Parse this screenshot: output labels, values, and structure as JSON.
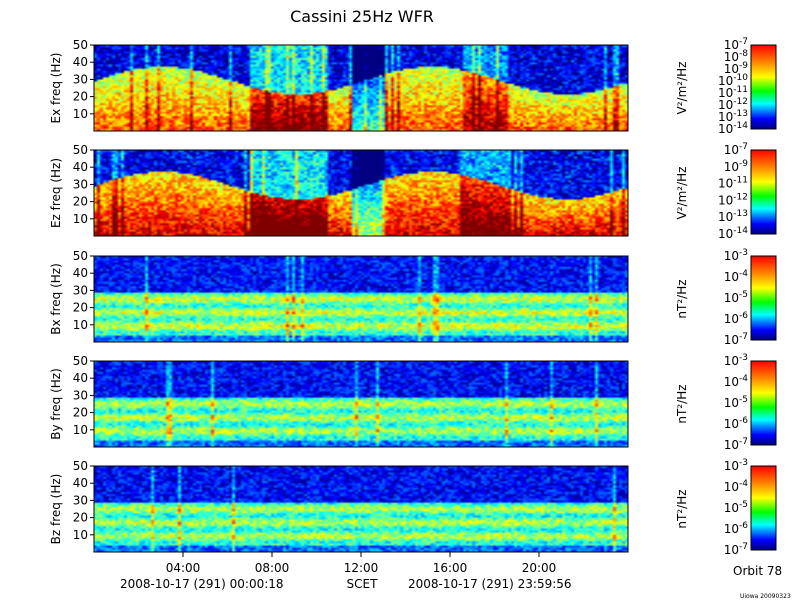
{
  "title": "Cassini 25Hz WFR",
  "chart_data": {
    "type": "heatmap",
    "title": "Cassini 25Hz WFR",
    "xlabel": "SCET",
    "xlim_hours": [
      0,
      24
    ],
    "x_ticks": [
      "04:00",
      "08:00",
      "12:00",
      "16:00",
      "20:00"
    ],
    "x_tick_hours": [
      4,
      8,
      12,
      16,
      20
    ],
    "start_time": "2008-10-17 (291) 00:00:18",
    "end_time": "2008-10-17 (291) 23:59:56",
    "panels": [
      {
        "ylabel": "Ex freq (Hz)",
        "ylim": [
          0,
          50
        ],
        "yticks": [
          "10",
          "20",
          "30",
          "40",
          "50"
        ],
        "colorbar_label": "V²/m²/Hz",
        "cmin_exp": -14,
        "cmax_exp": -7,
        "cbar_ticks": [
          "-7",
          "-8",
          "-9",
          "-10",
          "-11",
          "-12",
          "-13",
          "-14"
        ],
        "level": 1.0
      },
      {
        "ylabel": "Ez freq (Hz)",
        "ylim": [
          0,
          50
        ],
        "yticks": [
          "10",
          "20",
          "30",
          "40",
          "50"
        ],
        "colorbar_label": "V²/m²/Hz",
        "cmin_exp": -14,
        "cmax_exp": -7,
        "cbar_ticks": [
          "-7",
          "-9",
          "-11",
          "-12",
          "-13",
          "-14"
        ],
        "level": 1.15
      },
      {
        "ylabel": "Bx freq (Hz)",
        "ylim": [
          0,
          50
        ],
        "yticks": [
          "10",
          "20",
          "30",
          "40",
          "50"
        ],
        "colorbar_label": "nT²/Hz",
        "cmin_exp": -7,
        "cmax_exp": -3,
        "cbar_ticks": [
          "-3",
          "-4",
          "-5",
          "-6",
          "-7"
        ],
        "level": 0.55
      },
      {
        "ylabel": "By freq (Hz)",
        "ylim": [
          0,
          50
        ],
        "yticks": [
          "10",
          "20",
          "30",
          "40",
          "50"
        ],
        "colorbar_label": "nT²/Hz",
        "cmin_exp": -7,
        "cmax_exp": -3,
        "cbar_ticks": [
          "-3",
          "-4",
          "-5",
          "-6",
          "-7"
        ],
        "level": 0.5
      },
      {
        "ylabel": "Bz freq (Hz)",
        "ylim": [
          0,
          50
        ],
        "yticks": [
          "10",
          "20",
          "30",
          "40",
          "50"
        ],
        "colorbar_label": "nT²/Hz",
        "cmin_exp": -7,
        "cmax_exp": -3,
        "cbar_ticks": [
          "-3",
          "-4",
          "-5",
          "-6",
          "-7"
        ],
        "level": 0.5
      }
    ]
  },
  "footer": {
    "start": "2008-10-17 (291) 00:00:18",
    "scet": "SCET",
    "end": "2008-10-17 (291) 23:59:56",
    "orbit": "Orbit 78",
    "credit": "Uiowa 20090323"
  }
}
